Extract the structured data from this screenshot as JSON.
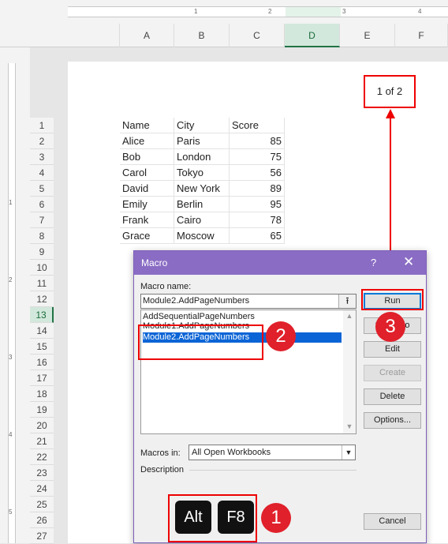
{
  "ruler": {
    "marks": [
      "1",
      "2",
      "3",
      "4"
    ]
  },
  "columns": [
    "A",
    "B",
    "C",
    "D",
    "E",
    "F"
  ],
  "selected_column": "D",
  "rows": [
    "1",
    "2",
    "3",
    "4",
    "5",
    "6",
    "7",
    "8",
    "9",
    "10",
    "11",
    "12",
    "13",
    "14",
    "15",
    "16",
    "17",
    "18",
    "19",
    "20",
    "21",
    "22",
    "23",
    "24",
    "25",
    "26",
    "27"
  ],
  "selected_row": "13",
  "vertical_ruler": [
    "1",
    "2",
    "3",
    "4",
    "5"
  ],
  "table": {
    "headers": [
      "Name",
      "City",
      "Score"
    ],
    "rows": [
      [
        "Alice",
        "Paris",
        "85"
      ],
      [
        "Bob",
        "London",
        "75"
      ],
      [
        "Carol",
        "Tokyo",
        "56"
      ],
      [
        "David",
        "New York",
        "89"
      ],
      [
        "Emily",
        "Berlin",
        "95"
      ],
      [
        "Frank",
        "Cairo",
        "78"
      ],
      [
        "Grace",
        "Moscow",
        "65"
      ]
    ]
  },
  "page_number": "1 of 2",
  "dialog": {
    "title": "Macro",
    "help": "?",
    "close": "✕",
    "macro_name_label": "Macro name:",
    "macro_name_value": "Module2.AddPageNumbers",
    "macros": [
      "AddSequentialPageNumbers",
      "Module1.AddPageNumbers",
      "Module2.AddPageNumbers"
    ],
    "selected_macro": "Module2.AddPageNumbers",
    "buttons": {
      "run": "Run",
      "step_into": "Step Into",
      "edit": "Edit",
      "create": "Create",
      "delete": "Delete",
      "options": "Options...",
      "cancel": "Cancel"
    },
    "macros_in_label": "Macros in:",
    "macros_in_value": "All Open Workbooks",
    "description_label": "Description"
  },
  "keys": [
    "Alt",
    "F8"
  ],
  "steps": [
    "1",
    "2",
    "3"
  ],
  "colors": {
    "annotation_red": "#e00000",
    "title_bar": "#8a6cc4",
    "selection_blue": "#0a64d6",
    "excel_green": "#217346"
  }
}
